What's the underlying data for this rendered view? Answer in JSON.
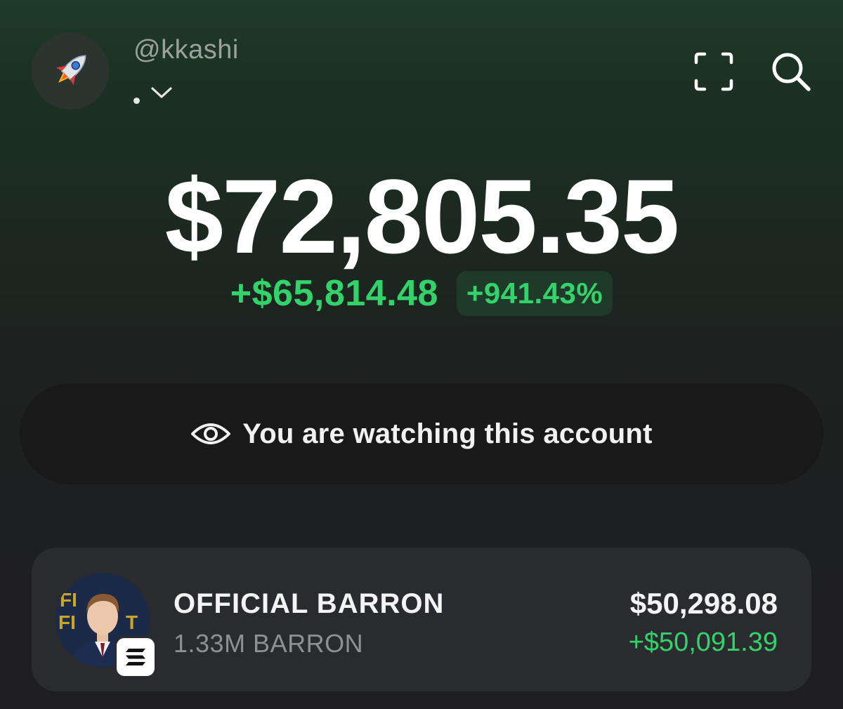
{
  "header": {
    "avatar_icon": "rocket-icon",
    "username": "@kkashi",
    "account_switch_icon": "chevron-down-icon",
    "scan_icon": "scan-frame-icon",
    "search_icon": "search-icon"
  },
  "portfolio": {
    "balance": "$72,805.35",
    "change_amount": "+$65,814.48",
    "change_percent": "+941.43%"
  },
  "watch_banner": {
    "icon": "eye-icon",
    "text": "You are watching this account"
  },
  "tokens": [
    {
      "name": "OFFICIAL BARRON",
      "amount": "1.33M BARRON",
      "value": "$50,298.08",
      "change": "+$50,091.39",
      "chain_icon": "solana-icon"
    }
  ],
  "colors": {
    "positive": "#33d26b",
    "positive_bg": "#1f3a29",
    "card_bg": "#2a2b2e",
    "banner_bg": "#181918"
  }
}
